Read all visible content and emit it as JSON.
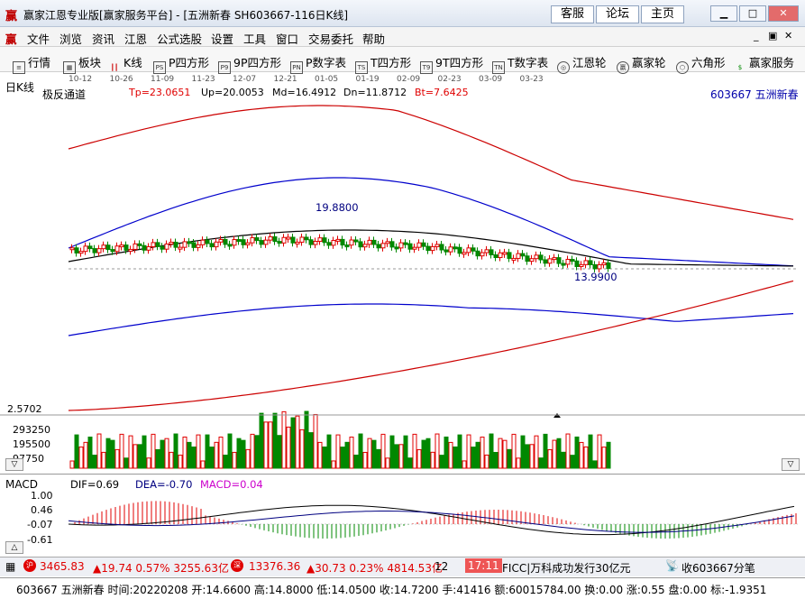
{
  "window": {
    "title": "赢家江恩专业版[赢家服务平台] - [五洲新春   SH603667-116日K线]",
    "buttons": [
      "客服",
      "论坛",
      "主页"
    ]
  },
  "menu": [
    "文件",
    "浏览",
    "资讯",
    "江恩",
    "公式选股",
    "设置",
    "工具",
    "窗口",
    "交易委托",
    "帮助"
  ],
  "toolbar": [
    "行情",
    "板块",
    "K线",
    "P四方形",
    "9P四方形",
    "P数字表",
    "T四方形",
    "9T四方形",
    "T数字表",
    "江恩轮",
    "赢家轮",
    "六角形",
    "赢家服务"
  ],
  "chart": {
    "period_label": "日K线",
    "dates": [
      "10-12",
      "10-26",
      "11-09",
      "11-23",
      "12-07",
      "12-21",
      "01-05",
      "01-19",
      "02-09",
      "02-23",
      "03-09",
      "03-23"
    ],
    "indicator_name": "极反通道",
    "params": {
      "tp": "Tp=23.0651",
      "up": "Up=20.0053",
      "md": "Md=16.4912",
      "dn": "Dn=11.8712",
      "bt": "Bt=7.6425"
    },
    "stock_label": "603667  五洲新春",
    "high_mark": "19.8800",
    "low_mark": "13.9900",
    "vol_scale": "2.5702",
    "vol_ticks": [
      "293250",
      "195500",
      "97750"
    ]
  },
  "macd": {
    "name": "MACD",
    "dif": "DIF=0.69",
    "dea": "DEA=-0.70",
    "macd": "MACD=0.04",
    "ticks": [
      "1.00",
      "0.46",
      "-0.07",
      "-0.61"
    ]
  },
  "status": {
    "sh": "3465.83",
    "sh_chg": "▲19.74  0.57%  3255.63亿",
    "sz": "13376.36",
    "sz_chg": "▲30.73  0.23%  4814.53亿",
    "num": "12",
    "time": "17:11",
    "news": "FICC|万科成功发行30亿元",
    "collect": "收603667分笔"
  },
  "info": "603667 五洲新春 时间:20220208 开:14.6600 高:14.8000 低:14.0500 收:14.7200 手:41416 额:60015784.00 换:0.00 涨:0.55 盘:0.00 标:-1.9351",
  "colors": {
    "up": "#e00000",
    "down": "#008800",
    "mid": "#000000",
    "inner": "#0000cc",
    "outer": "#cc0000"
  }
}
